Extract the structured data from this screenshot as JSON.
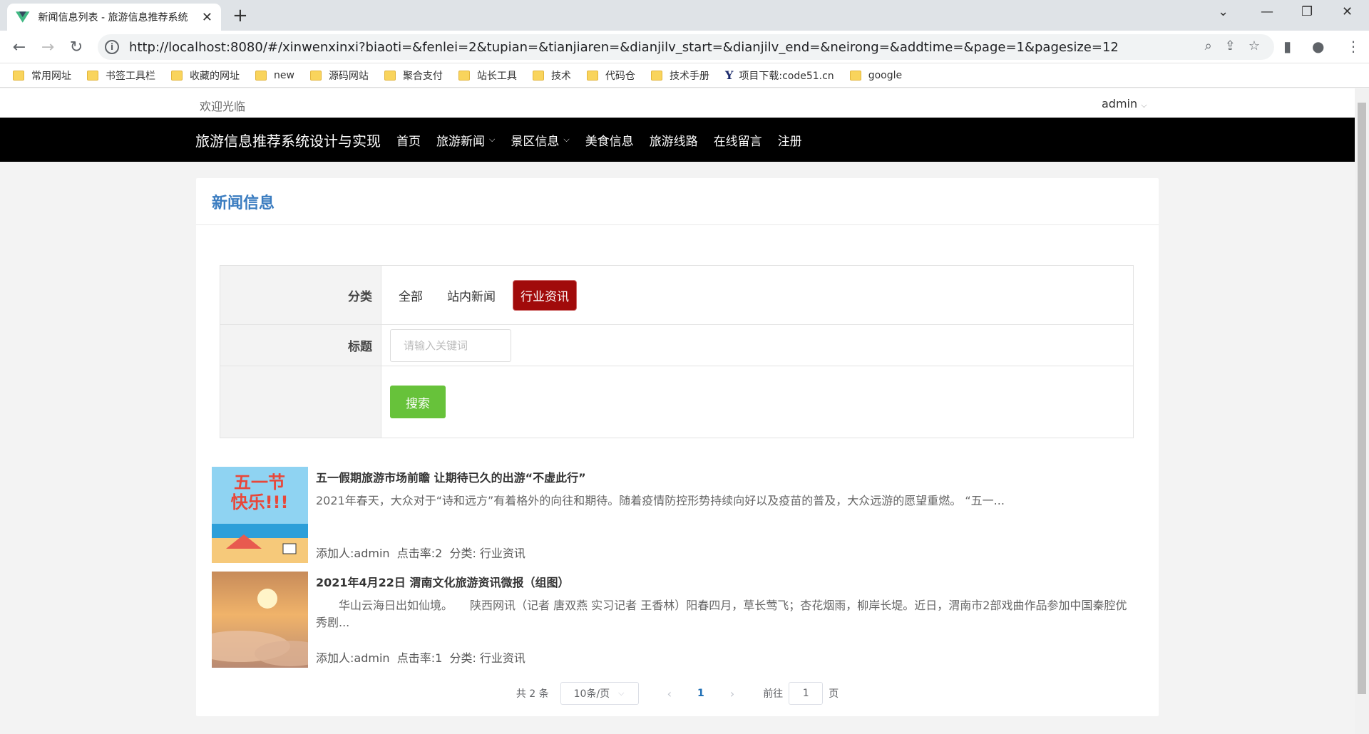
{
  "browser": {
    "tab_title": "新闻信息列表 - 旅游信息推荐系统",
    "url": "http://localhost:8080/#/xinwenxinxi?biaoti=&fenlei=2&tupian=&tianjiaren=&dianjilv_start=&dianjilv_end=&neirong=&addtime=&page=1&pagesize=12",
    "bookmarks": [
      "常用网址",
      "书签工具栏",
      "收藏的网址",
      "new",
      "源码网站",
      "聚合支付",
      "站长工具",
      "技术",
      "代码仓",
      "技术手册",
      "项目下载:code51.cn",
      "google"
    ]
  },
  "header": {
    "welcome": "欢迎光临",
    "user": "admin",
    "brand": "旅游信息推荐系统设计与实现",
    "nav": [
      "首页",
      "旅游新闻",
      "景区信息",
      "美食信息",
      "旅游线路",
      "在线留言",
      "注册"
    ]
  },
  "main": {
    "title": "新闻信息",
    "filter": {
      "category_label": "分类",
      "categories": [
        "全部",
        "站内新闻",
        "行业资讯"
      ],
      "active_category": "行业资讯",
      "title_label": "标题",
      "keyword_placeholder": "请输入关键词",
      "search_label": "搜索"
    },
    "news": [
      {
        "title": "五一假期旅游市场前瞻 让期待已久的出游“不虚此行”",
        "desc": "2021年春天，大众对于“诗和远方”有着格外的向往和期待。随着疫情防控形势持续向好以及疫苗的普及，大众远游的愿望重燃。 “五一...",
        "meta": "添加人:admin  点击率:2  分类: 行业资讯",
        "image_text": "五一节快乐!!!"
      },
      {
        "title": "2021年4月22日 渭南文化旅游资讯微报（组图）",
        "desc": "　　华山云海日出如仙境。　　陕西网讯（记者 唐双燕 实习记者 王香林）阳春四月，草长莺飞；杏花烟雨，柳岸长堤。近日，渭南市2部戏曲作品参加中国秦腔优秀剧...",
        "meta": "添加人:admin  点击率:1  分类: 行业资讯"
      }
    ],
    "pagination": {
      "total": "共 2 条",
      "page_size": "10条/页",
      "current": "1",
      "goto_prefix": "前往",
      "goto_value": "1",
      "goto_suffix": "页"
    }
  }
}
